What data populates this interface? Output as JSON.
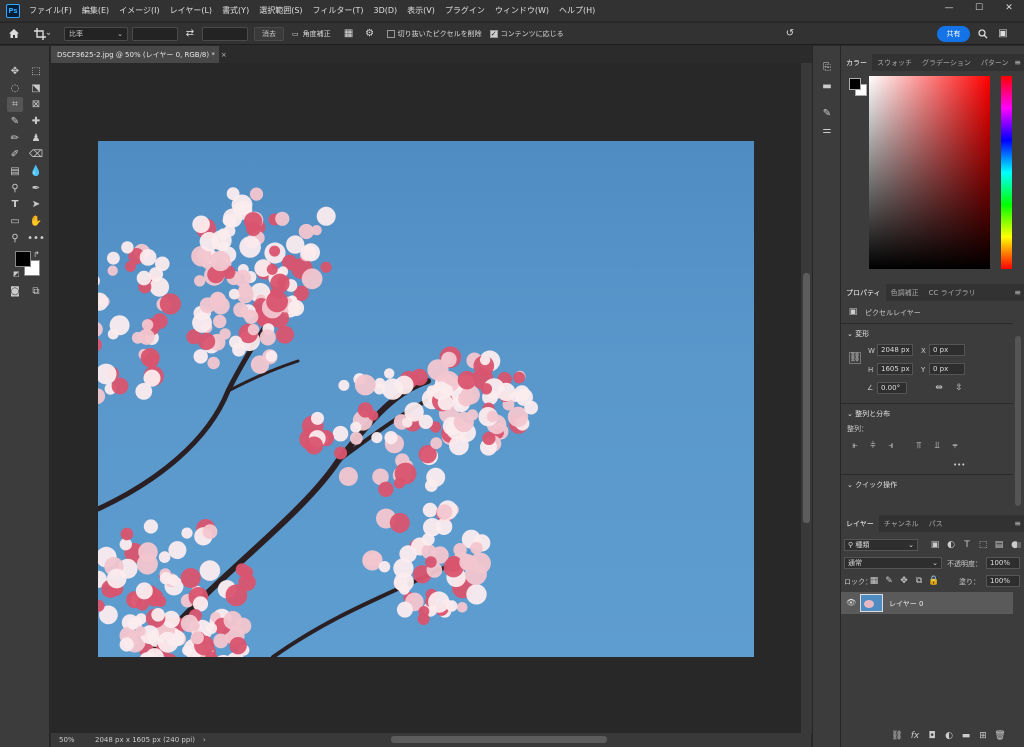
{
  "app": {
    "logo": "Ps"
  },
  "menu": [
    "ファイル(F)",
    "編集(E)",
    "イメージ(I)",
    "レイヤー(L)",
    "書式(Y)",
    "選択範囲(S)",
    "フィルター(T)",
    "3D(D)",
    "表示(V)",
    "プラグイン",
    "ウィンドウ(W)",
    "ヘルプ(H)"
  ],
  "window_controls": {
    "minimize": "—",
    "maximize": "☐",
    "close": "✕"
  },
  "options": {
    "ratio_value": "比率",
    "clear_label": "消去",
    "straighten_label": "角度補正",
    "delete_cropped_label": "切り抜いたピクセルを削除",
    "delete_cropped_checked": false,
    "content_aware_label": "コンテンツに応じる",
    "content_aware_checked": true,
    "share_label": "共有"
  },
  "document": {
    "tab_title": "DSCF3625-2.jpg @ 50% (レイヤー 0, RGB/8) *",
    "close": "×"
  },
  "status": {
    "zoom": "50%",
    "info": "2048 px x 1605 px (240 ppi)",
    "arrow": "›"
  },
  "color_panel": {
    "tabs": [
      "カラー",
      "スウォッチ",
      "グラデーション",
      "パターン"
    ],
    "active_tab": 0,
    "picker_hue_color": "#ff0000",
    "foreground": "#000000",
    "background": "#ffffff"
  },
  "properties_panel": {
    "tabs": [
      "プロパティ",
      "色調補正",
      "CC ライブラリ"
    ],
    "active_tab": 0,
    "layer_type": "ピクセルレイヤー",
    "transform_header": "変形",
    "w_label": "W",
    "w_value": "2048 px",
    "h_label": "H",
    "h_value": "1605 px",
    "x_label": "X",
    "x_value": "0 px",
    "y_label": "Y",
    "y_value": "0 px",
    "angle_value": "0.00°",
    "align_header": "整列と分布",
    "align_label": "整列：",
    "more": "•••",
    "quick_actions_header": "クイック操作"
  },
  "layers_panel": {
    "tabs": [
      "レイヤー",
      "チャンネル",
      "パス"
    ],
    "active_tab": 0,
    "filter_kind": "種類",
    "blend_mode": "通常",
    "opacity_label": "不透明度：",
    "opacity_value": "100%",
    "lock_label": "ロック：",
    "fill_label": "塗り：",
    "fill_value": "100%",
    "layers": [
      {
        "name": "レイヤー 0",
        "visible": true
      }
    ]
  }
}
